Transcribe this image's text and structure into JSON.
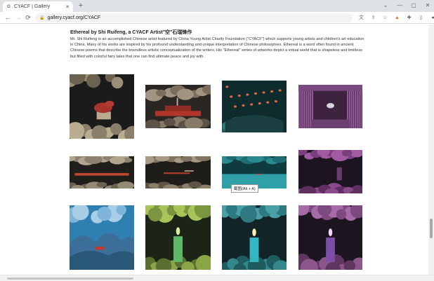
{
  "browser": {
    "tab_favicon": "G",
    "tab_title": "CYACF | Gallery",
    "tab_close": "✕",
    "new_tab": "+",
    "address": "gallery.cyacf.org/CYACF",
    "window_controls": [
      "⌄",
      "—",
      "▢",
      "✕"
    ],
    "nav": {
      "back": "←",
      "forward": "→",
      "reload": "⟳"
    },
    "toolbar_icons": [
      "translate-icon",
      "share-icon",
      "star-icon",
      "fox-extension-icon",
      "puzzle-icon",
      "sidebar-icon",
      "profile-icon",
      "menu-icon"
    ]
  },
  "page": {
    "heading": "Ethereal by Shi Ruifeng, a CYACF Artist\"空\"石瑞锋作",
    "description": "Mr. Shi Ruifeng is an accomplished Chinese artist featured by China Young Artist Charity Foundation (\"CYACF\") which supports young artists and children's art education in China. Many of his works are inspired by his profound understanding and unique interpretation of Chinese philosophies. Ethereal is a word often found in ancient Chinese poems that describe the boundless artistic conceptualization of the writers. His \"Ethereal\" series of artworks depict a virtual world that is shapeless and limitless but filled with colorful fairy tales that one can find ultimate peace and joy with.",
    "tooltip": "截图(Alt + A)"
  },
  "gallery": [
    {
      "name": "artwork-mushroom-house",
      "scene": "house"
    },
    {
      "name": "artwork-red-ship",
      "scene": "ship"
    },
    {
      "name": "artwork-lanterns-rooftop",
      "scene": "lanterns"
    },
    {
      "name": "artwork-purple-stage",
      "scene": "stage"
    },
    {
      "name": "artwork-orange-bridge",
      "scene": "bridge"
    },
    {
      "name": "artwork-clouds-boat",
      "scene": "boat"
    },
    {
      "name": "artwork-teal-boat",
      "scene": "tealboat"
    },
    {
      "name": "artwork-purple-forest",
      "scene": "purplecliff"
    },
    {
      "name": "artwork-blue-mountains-red-car",
      "scene": "mountains"
    },
    {
      "name": "artwork-green-candle",
      "scene": "greencandle"
    },
    {
      "name": "artwork-teal-candle",
      "scene": "tealcandle"
    },
    {
      "name": "artwork-purple-candle",
      "scene": "purplecandle"
    }
  ]
}
